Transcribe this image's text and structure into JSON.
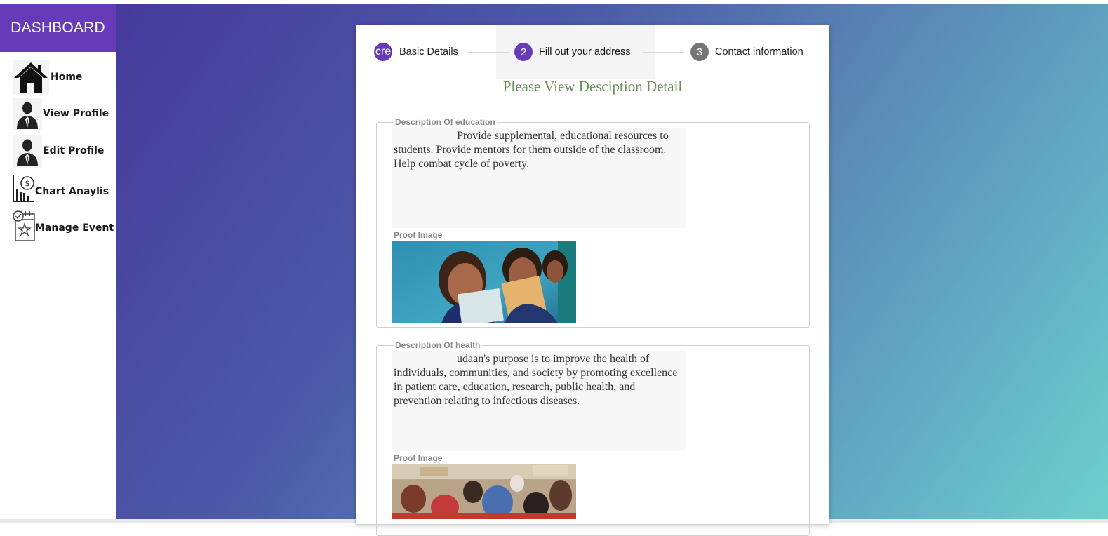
{
  "sidebar": {
    "brand": "DASHBOARD",
    "items": [
      {
        "label": "Home",
        "icon": "home-icon"
      },
      {
        "label": "View Profile",
        "icon": "user-icon"
      },
      {
        "label": "Edit Profile",
        "icon": "user-icon"
      },
      {
        "label": "Chart Anaylis",
        "icon": "chart-icon"
      },
      {
        "label": "Manage Event",
        "icon": "calendar-star-icon"
      }
    ]
  },
  "stepper": {
    "steps": [
      {
        "number": "cre",
        "label": "Basic Details",
        "state": "done"
      },
      {
        "number": "2",
        "label": "Fill out your address",
        "state": "active"
      },
      {
        "number": "3",
        "label": "Contact information",
        "state": "pending"
      }
    ]
  },
  "page": {
    "heading": "Please View Desciption Detail"
  },
  "sections": [
    {
      "legend": "Description Of education",
      "text": "Provide supplemental, educational resources to students. Provide mentors for them outside of the classroom. Help combat cycle of poverty.",
      "proof_label": "Proof Image"
    },
    {
      "legend": "Description Of health",
      "text": "udaan's purpose is to improve the health of individuals, communities, and society by promoting excellence in patient care, education, research, public health, and prevention relating to infectious diseases.",
      "proof_label": "Proof Image"
    }
  ],
  "colors": {
    "brand": "#673ab7",
    "step_done": "#673ab7",
    "step_active": "#673ab7",
    "step_pending": "#757575",
    "heading": "#6b8e5a"
  }
}
